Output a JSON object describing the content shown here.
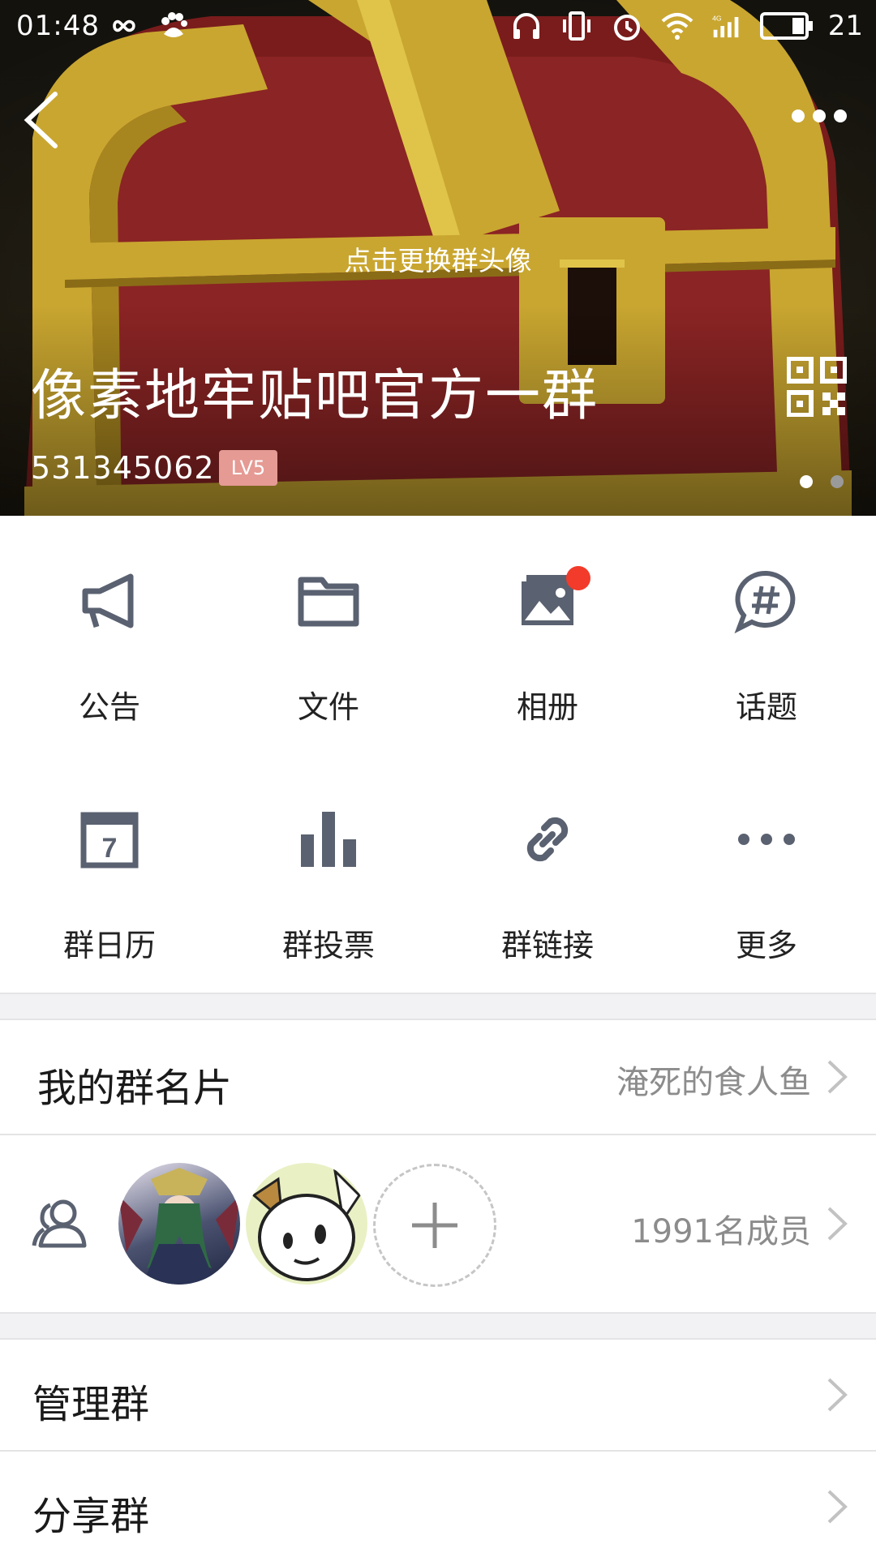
{
  "status_bar": {
    "time": "01:48",
    "battery_level": "21",
    "icons": [
      "infinity-icon",
      "baidu-paw-icon",
      "headphones-icon",
      "vibrate-icon",
      "alarm-icon",
      "wifi-icon",
      "signal-4g-icon",
      "battery-icon"
    ]
  },
  "header": {
    "change_avatar_hint": "点击更换群头像",
    "group_name": "像素地牢贴吧官方一群",
    "group_id": "531345062",
    "level_badge": "LV5",
    "page_indicator": {
      "count": 2,
      "active": 1
    }
  },
  "features": [
    {
      "label": "公告",
      "icon": "megaphone-icon",
      "has_badge": false
    },
    {
      "label": "文件",
      "icon": "folder-icon",
      "has_badge": false
    },
    {
      "label": "相册",
      "icon": "photo-album-icon",
      "has_badge": true
    },
    {
      "label": "话题",
      "icon": "hashtag-chat-icon",
      "has_badge": false
    },
    {
      "label": "群日历",
      "icon": "calendar-icon",
      "has_badge": false
    },
    {
      "label": "群投票",
      "icon": "bar-chart-icon",
      "has_badge": false
    },
    {
      "label": "群链接",
      "icon": "link-icon",
      "has_badge": false
    },
    {
      "label": "更多",
      "icon": "more-dots-icon",
      "has_badge": false
    }
  ],
  "calendar_day": "7",
  "group_card": {
    "title": "我的群名片",
    "value": "淹死的食人鱼"
  },
  "members": {
    "count_text": "1991名成员"
  },
  "manage": {
    "title": "管理群"
  },
  "share": {
    "title": "分享群"
  },
  "colors": {
    "icon_gray": "#5a6170",
    "badge_red": "#f23b2a",
    "level_badge": "#e59a94",
    "chest_red": "#7a1c1c",
    "chest_gold": "#c9a630"
  }
}
